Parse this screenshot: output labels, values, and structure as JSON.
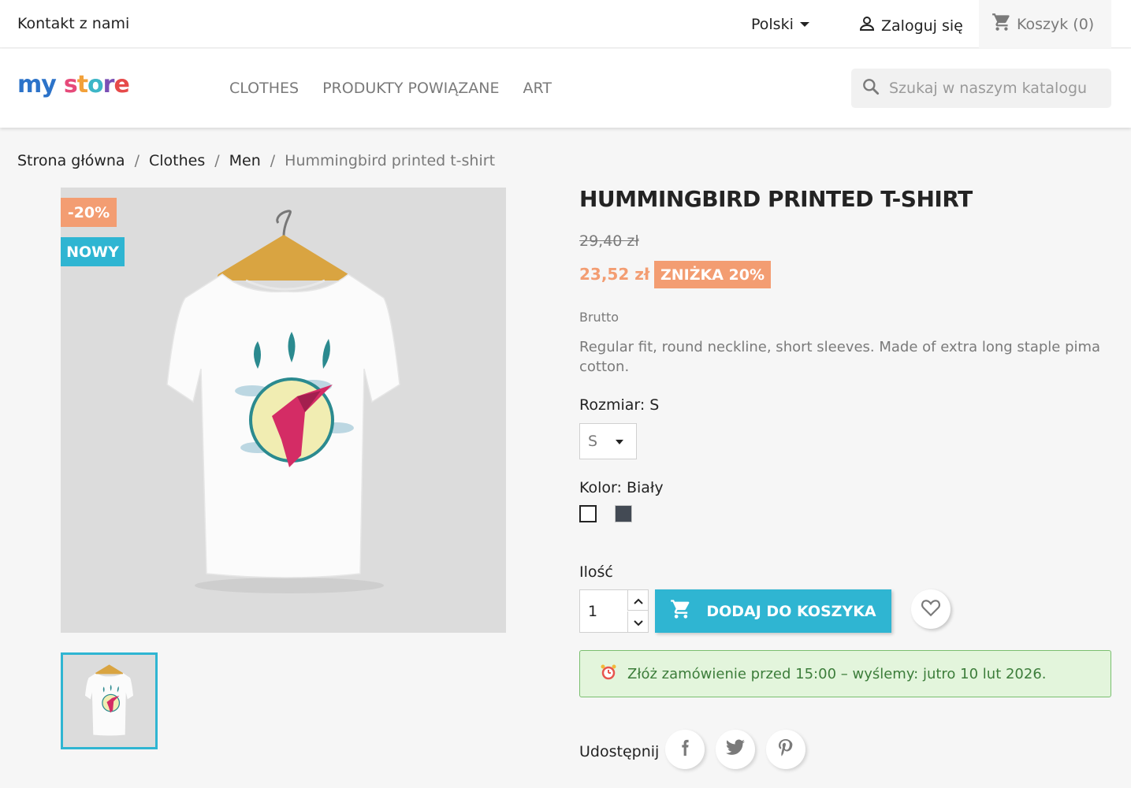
{
  "topbar": {
    "contact": "Kontakt z nami",
    "language": "Polski",
    "login": "Zaloguj się",
    "cart": "Koszyk (0)"
  },
  "header": {
    "logo_my": "my",
    "logo_store": "store",
    "nav": [
      "CLOTHES",
      "PRODUKTY POWIĄZANE",
      "ART"
    ],
    "search_placeholder": "Szukaj w naszym katalogu"
  },
  "breadcrumb": {
    "items": [
      "Strona główna",
      "Clothes",
      "Men"
    ],
    "current": "Hummingbird printed t-shirt",
    "separator": "/"
  },
  "product": {
    "badge_discount": "-20%",
    "badge_new": "NOWY",
    "title": "HUMMINGBIRD PRINTED T-SHIRT",
    "old_price": "29,40 zł",
    "price": "23,52 zł",
    "discount_label": "ZNIŻKA 20%",
    "tax_label": "Brutto",
    "description": "Regular fit, round neckline, short sleeves. Made of extra long staple pima cotton.",
    "size_label": "Rozmiar: S",
    "size_value": "S",
    "color_label": "Kolor: Biały",
    "colors": [
      {
        "name": "white",
        "hex": "#ffffff"
      },
      {
        "name": "dark-grey",
        "hex": "#434a54"
      }
    ],
    "quantity_label": "Ilość",
    "quantity": "1",
    "add_to_cart": "DODAJ DO KOSZYKA",
    "delivery": "Złóż zamówienie przed 15:00 – wyślemy: jutro 10 lut 2026.",
    "share_label": "Udostępnij"
  },
  "colors": {
    "accent": "#2fb5d2",
    "discount": "#f39d72",
    "delivery_bg": "#e3f5dc"
  }
}
